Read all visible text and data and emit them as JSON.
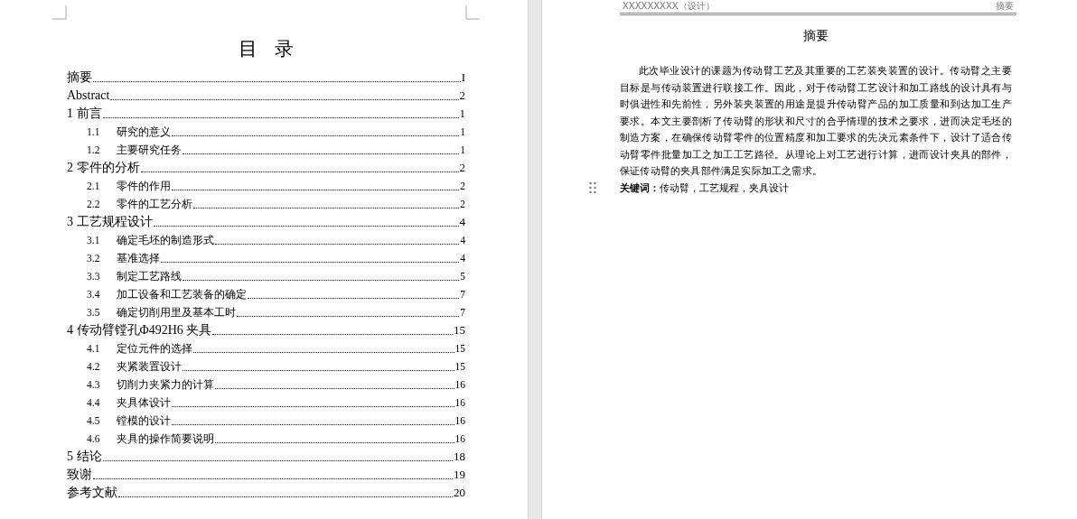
{
  "left_page": {
    "toc_title": "目 录",
    "entries": [
      {
        "title": "摘要",
        "page": "I"
      },
      {
        "title": "Abstract",
        "page": "2"
      },
      {
        "title": "1  前言",
        "page": "1",
        "children": [
          {
            "number": "1.1",
            "title": "研究的意义",
            "page": "1"
          },
          {
            "number": "1.2",
            "title": "主要研究任务",
            "page": "1"
          }
        ]
      },
      {
        "title": "2  零件的分析",
        "page": "2",
        "children": [
          {
            "number": "2.1",
            "title": "零件的作用",
            "page": "2"
          },
          {
            "number": "2.2",
            "title": "零件的工艺分析",
            "page": "2"
          }
        ]
      },
      {
        "title": "3  工艺规程设计",
        "page": "4",
        "children": [
          {
            "number": "3.1",
            "title": "确定毛坯的制造形式",
            "page": "4"
          },
          {
            "number": "3.2",
            "title": "基准选择",
            "page": "4"
          },
          {
            "number": "3.3",
            "title": "制定工艺路线",
            "page": "5"
          },
          {
            "number": "3.4",
            "title": "加工设备和工艺装备的确定",
            "page": "7"
          },
          {
            "number": "3.5",
            "title": "确定切削用里及基本工时",
            "page": "7"
          }
        ]
      },
      {
        "title": "4  传动臂镗孔Φ492H6 夹具",
        "page": "15",
        "children": [
          {
            "number": "4.1",
            "title": "定位元件的选择",
            "page": "15"
          },
          {
            "number": "4.2",
            "title": "夹紧装置设计",
            "page": "15"
          },
          {
            "number": "4.3",
            "title": "切削力夹紧力的计算",
            "page": "16"
          },
          {
            "number": "4.4",
            "title": "夹具体设计",
            "page": "16"
          },
          {
            "number": "4.5",
            "title": "镗模的设计",
            "page": "16"
          },
          {
            "number": "4.6",
            "title": "夹具的操作简要说明",
            "page": "16"
          }
        ]
      },
      {
        "title": "5  结论",
        "page": "18"
      },
      {
        "title": "致谢",
        "page": "19"
      },
      {
        "title": "参考文献",
        "page": "20"
      }
    ]
  },
  "right_page": {
    "header_left": "XXXXXXXXX（设计）",
    "header_right": "摘要",
    "heading": "摘要",
    "paragraph": "此次毕业设计的课题为传动臂工艺及其重要的工艺装夹装置的设计。传动臂之主要目标是与传动装置进行联接工作。因此，对于传动臂工艺设计和加工路线的设计具有与时俱进性和先前性，另外装夹装置的用途是提升传动臂产品的加工质量和到达加工生产要求。本文主要剖析了传动臂的形状和尺寸的合乎情理的技术之要求，进而决定毛坯的制造方案，在确保传动臂零件的位置精度和加工要求的先决元素条件下，设计了适合传动臂零件批量加工之加工工艺路径。从理论上对工艺进行计算，进而设计夹具的部件，保证传动臂的夹具部件满足实际加工之需求。",
    "keywords": "**关键词：**传动臂，工艺规程，夹具设计"
  }
}
